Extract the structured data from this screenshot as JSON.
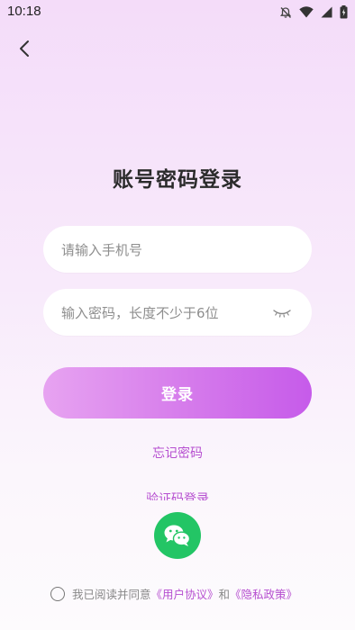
{
  "status_bar": {
    "time": "10:18",
    "icons": [
      "bell-muted-icon",
      "wifi-icon",
      "signal-icon",
      "battery-icon"
    ]
  },
  "header": {
    "back_icon": "chevron-left-icon"
  },
  "page": {
    "title": "账号密码登录"
  },
  "form": {
    "phone_placeholder": "请输入手机号",
    "password_placeholder": "输入密码，长度不少于6位",
    "eye_icon": "eye-closed-icon",
    "login_label": "登录",
    "forgot_label": "忘记密码",
    "sms_login_label": "验证码登录"
  },
  "social": {
    "wechat_icon": "wechat-icon"
  },
  "agreement": {
    "prefix": "我已阅读并同意",
    "user_agreement": "《用户协议》",
    "and": "和",
    "privacy_policy": "《隐私政策》"
  },
  "colors": {
    "accent": "#b64fd0",
    "button_start": "#e7a3f1",
    "button_end": "#c65bea",
    "wechat": "#23c565"
  }
}
